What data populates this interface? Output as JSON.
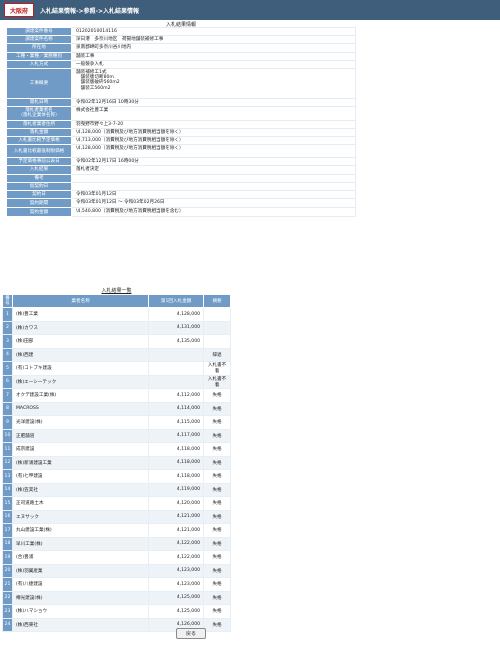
{
  "header": {
    "logo": "大阪府",
    "breadcrumb": "入札結果情報->参照->入札結果情報"
  },
  "info_title": "入札結果情報",
  "info_rows": [
    {
      "label": "調達案件番号",
      "value": "01202010014116"
    },
    {
      "label": "調達案件名称",
      "value": "深日港　多奈川地区　荷揚地舗装補修工事"
    },
    {
      "label": "所在地",
      "value": "泉南郡岬町多奈川谷川地内"
    },
    {
      "label": "工種・業種／業務種別",
      "value": "舗装工事"
    },
    {
      "label": "入札方式",
      "value": "一般競争入札"
    },
    {
      "label": "工事概要",
      "value": "舗装補修工1式\n　舗装版切断80m\n　舗装版破砕560m2\n　舗装工560m2"
    },
    {
      "label": "開札日時",
      "value": "令和02年12月16日 10時30分"
    },
    {
      "label": "落札者業者名\n（落札企業体名称）",
      "value": "株式会社豊工業"
    },
    {
      "label": "落札者業者住所",
      "value": "羽曳野市野々上3-7-20"
    },
    {
      "label": "落札金額",
      "value": "\\4,128,000（消費税及び地方消費税相当額を除く）"
    },
    {
      "label": "入札書比較予定価格",
      "value": "\\4,713,000（消費税及び地方消費税相当額を除く）"
    },
    {
      "label": "入札書比較最低制限価格",
      "value": "\\4,128,000（消費税及び地方消費税相当額を除く）"
    },
    {
      "label": "予定価格事前公表日",
      "value": "令和02年12月17日 16時00分"
    },
    {
      "label": "入札結果",
      "value": "落札者決定"
    },
    {
      "label": "備考",
      "value": ""
    },
    {
      "label": "仮契約日",
      "value": ""
    },
    {
      "label": "契約日",
      "value": "令和03年01月12日"
    },
    {
      "label": "契約期間",
      "value": "令和03年01月12日 ～ 令和03年02月26日"
    },
    {
      "label": "契約金額",
      "value": "\\4,540,800（消費税及び地方消費税相当額を含む）"
    }
  ],
  "results_title": "入札結果一覧",
  "results_headers": {
    "no": "番号",
    "name": "業者名称",
    "amount": "第1回入札金額",
    "remark": "摘要"
  },
  "results": [
    {
      "no": "1",
      "name": "(株)豊工業",
      "amount": "4,128,000",
      "remark": ""
    },
    {
      "no": "2",
      "name": "(株)カワス",
      "amount": "4,131,000",
      "remark": ""
    },
    {
      "no": "3",
      "name": "(株)田部",
      "amount": "4,135,000",
      "remark": ""
    },
    {
      "no": "4",
      "name": "(株)西建",
      "amount": "",
      "remark": "辞退"
    },
    {
      "no": "5",
      "name": "(有)コトブキ建設",
      "amount": "",
      "remark": "入札書不着"
    },
    {
      "no": "6",
      "name": "(株)エーシーテック",
      "amount": "",
      "remark": "入札書不着"
    },
    {
      "no": "7",
      "name": "オクデ建設工業(株)",
      "amount": "4,112,000",
      "remark": "失格"
    },
    {
      "no": "8",
      "name": "MACROSS",
      "amount": "4,114,000",
      "remark": "失格"
    },
    {
      "no": "9",
      "name": "光洋建設(株)",
      "amount": "4,115,000",
      "remark": "失格"
    },
    {
      "no": "10",
      "name": "正肥舗道",
      "amount": "4,117,000",
      "remark": "失格"
    },
    {
      "no": "11",
      "name": "成宗建設",
      "amount": "4,118,000",
      "remark": "失格"
    },
    {
      "no": "12",
      "name": "(株)新涌建設工業",
      "amount": "4,118,000",
      "remark": "失格"
    },
    {
      "no": "13",
      "name": "(有)七甲建設",
      "amount": "4,118,000",
      "remark": "失格"
    },
    {
      "no": "14",
      "name": "(株)笠実社",
      "amount": "4,119,000",
      "remark": "失格"
    },
    {
      "no": "15",
      "name": "正司道路土木",
      "amount": "4,120,000",
      "remark": "失格"
    },
    {
      "no": "16",
      "name": "エヌサック",
      "amount": "4,121,000",
      "remark": "失格"
    },
    {
      "no": "17",
      "name": "丸山建設工業(株)",
      "amount": "4,121,000",
      "remark": "失格"
    },
    {
      "no": "18",
      "name": "早川工業(株)",
      "amount": "4,122,000",
      "remark": "失格"
    },
    {
      "no": "19",
      "name": "(合)豊浦",
      "amount": "4,122,000",
      "remark": "失格"
    },
    {
      "no": "20",
      "name": "(株)羽翼産業",
      "amount": "4,123,000",
      "remark": "失格"
    },
    {
      "no": "21",
      "name": "(有)八捷建設",
      "amount": "4,123,000",
      "remark": "失格"
    },
    {
      "no": "22",
      "name": "樽光建設(株)",
      "amount": "4,125,000",
      "remark": "失格"
    },
    {
      "no": "23",
      "name": "(株)ハマショウ",
      "amount": "4,125,000",
      "remark": "失格"
    },
    {
      "no": "24",
      "name": "(株)西東社",
      "amount": "4,126,000",
      "remark": "失格"
    }
  ],
  "back_label": "戻る"
}
